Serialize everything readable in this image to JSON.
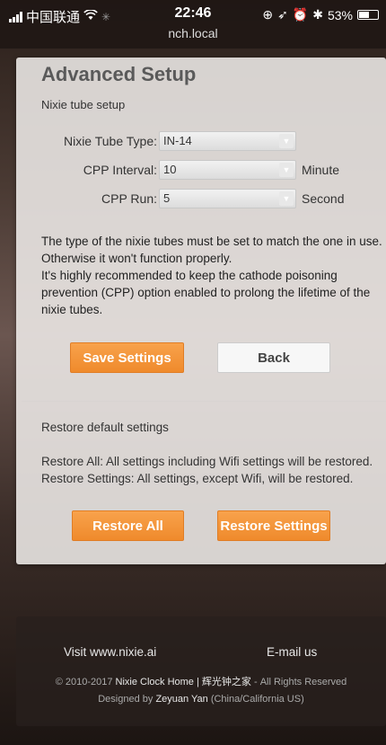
{
  "status_bar": {
    "carrier": "中国联通",
    "time": "22:46",
    "url": "nch.local",
    "battery": "53%",
    "battery_level": 0.53,
    "icons": [
      "signal-icon",
      "wifi-icon",
      "activity-icon",
      "lock-rotation-icon",
      "location-icon",
      "alarm-icon",
      "bluetooth-icon",
      "battery-icon"
    ]
  },
  "page": {
    "title": "Advanced Setup",
    "subtitle": "Nixie tube setup"
  },
  "form": {
    "tube_type": {
      "label": "Nixie Tube Type:",
      "value": "IN-14"
    },
    "cpp_interval": {
      "label": "CPP Interval:",
      "value": "10",
      "unit": "Minute"
    },
    "cpp_run": {
      "label": "CPP Run:",
      "value": "5",
      "unit": "Second"
    }
  },
  "description": {
    "line1": "The type of the nixie tubes must be set to match the one in use. Otherwise it won't function properly.",
    "line2": "It's highly recommended to keep the cathode poisoning prevention (CPP) option enabled to prolong the lifetime of the nixie tubes."
  },
  "buttons": {
    "save": "Save Settings",
    "back": "Back",
    "restore_all": "Restore All",
    "restore_settings": "Restore Settings"
  },
  "restore": {
    "title": "Restore default settings",
    "all_desc": "Restore All: All settings including Wifi settings will be restored.",
    "settings_desc": "Restore Settings: All settings, except Wifi, will be restored."
  },
  "footer": {
    "visit": "Visit www.nixie.ai",
    "email": "E-mail us",
    "copy_prefix": "© 2010-2017",
    "copy_link": "Nixie Clock Home | 辉光钟之家",
    "copy_suffix": "- All Rights Reserved",
    "designed_prefix": "Designed by",
    "designer": "Zeyuan Yan",
    "designed_suffix": "(China/California US)"
  },
  "colors": {
    "accent": "#f39a3d",
    "panel": "#eeeae8"
  }
}
